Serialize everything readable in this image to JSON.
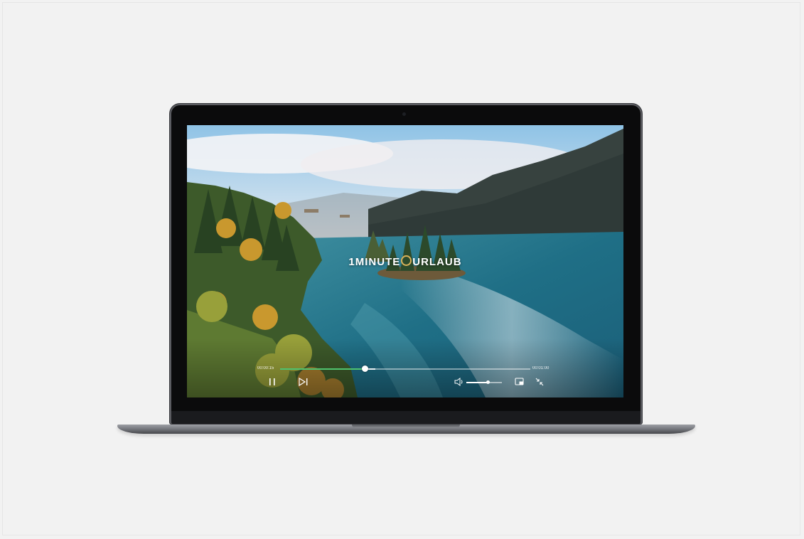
{
  "player": {
    "brand_prefix": "1MINUTE",
    "brand_suffix": "URLAUB",
    "current_time": "00:00:15",
    "total_time": "00:01:00",
    "progress_fraction": 0.34,
    "buffer_fraction": 0.38,
    "volume_fraction": 0.6
  },
  "icons": {
    "pause": "pause-icon",
    "next": "skip-next-icon",
    "volume": "volume-icon",
    "pip": "picture-in-picture-icon",
    "minimize": "exit-fullscreen-icon"
  },
  "colors": {
    "progress": "#4fc36f",
    "brand_accent": "#d8b25a"
  }
}
